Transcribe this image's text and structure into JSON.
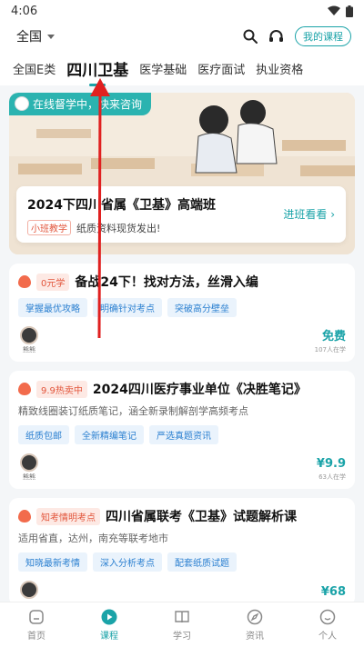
{
  "status": {
    "time": "4:06"
  },
  "topbar": {
    "region": "全国",
    "my_courses": "我的课程"
  },
  "categories": [
    {
      "label": "全国E类"
    },
    {
      "label": "四川卫基",
      "active": true
    },
    {
      "label": "医学基础"
    },
    {
      "label": "医疗面试"
    },
    {
      "label": "执业资格"
    }
  ],
  "banner": {
    "chip": "在线督学中，快来咨询",
    "title": "2024下四川省属《卫基》高端班",
    "tag": "小班教学",
    "subtitle": "纸质资料现货发出!",
    "link": "进班看看 ›"
  },
  "courses": [
    {
      "badge": "0元学",
      "title": "备战24下！找对方法，丝滑入编",
      "desc": "",
      "tags": [
        "掌握最优攻略",
        "明确针对考点",
        "突破高分壁垒"
      ],
      "teacher": "熊熊",
      "price": "免费",
      "learners": "107人在学"
    },
    {
      "badge": "9.9热卖中",
      "title": "2024四川医疗事业单位《决胜笔记》",
      "desc": "精致线圈装订纸质笔记，涵全新录制解剖学高频考点",
      "tags": [
        "纸质包邮",
        "全新精编笔记",
        "严选真题资讯"
      ],
      "teacher": "熊熊",
      "price": "¥9.9",
      "learners": "63人在学"
    },
    {
      "badge": "知考情明考点",
      "title": "四川省属联考《卫基》试题解析课",
      "desc": "适用省直，达州，南充等联考地市",
      "tags": [
        "知晓最新考情",
        "深入分析考点",
        "配套纸质试题"
      ],
      "teacher": "",
      "price": "¥68",
      "learners": ""
    }
  ],
  "tabbar": [
    {
      "label": "首页",
      "icon": "home-icon"
    },
    {
      "label": "课程",
      "icon": "play-icon",
      "active": true
    },
    {
      "label": "学习",
      "icon": "book-icon"
    },
    {
      "label": "资讯",
      "icon": "compass-icon"
    },
    {
      "label": "个人",
      "icon": "smile-icon"
    }
  ],
  "colors": {
    "accent": "#1aa3a8",
    "hot": "#e2553b",
    "arrow": "#e02020"
  }
}
